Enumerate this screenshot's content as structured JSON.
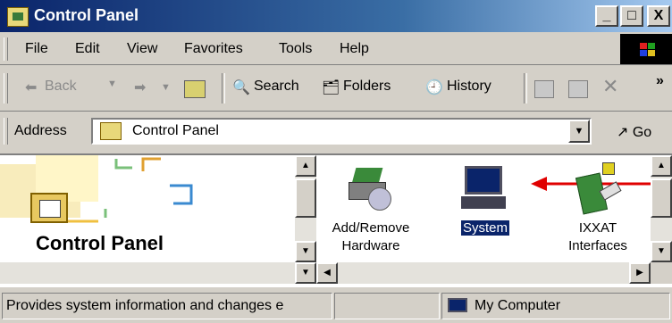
{
  "window": {
    "title": "Control Panel",
    "minimize": "_",
    "maximize": "□",
    "close": "X"
  },
  "menu": {
    "items": [
      "File",
      "Edit",
      "View",
      "Favorites",
      "Tools",
      "Help"
    ]
  },
  "toolbar": {
    "back_label": "Back",
    "forward_arrow": "➡",
    "search_label": "Search",
    "folders_label": "Folders",
    "history_label": "History",
    "more_glyph": "»"
  },
  "address": {
    "label": "Address",
    "value": "Control Panel",
    "go_label": "Go"
  },
  "left_pane": {
    "title": "Control Panel"
  },
  "items": [
    {
      "label_line1": "Add/Remove",
      "label_line2": "Hardware",
      "icon": "add-remove-hardware-icon"
    },
    {
      "label_line1": "System",
      "label_line2": "",
      "icon": "system-computer-icon",
      "selected": true
    },
    {
      "label_line1": "IXXAT",
      "label_line2": "Interfaces",
      "icon": "ixxat-card-icon"
    }
  ],
  "annotation": {
    "arrow_color": "#e00000"
  },
  "status": {
    "message": "Provides system information and changes e",
    "zone": "My Computer"
  },
  "colors": {
    "title_bar": "#0a246a",
    "selection": "#0a246a"
  }
}
